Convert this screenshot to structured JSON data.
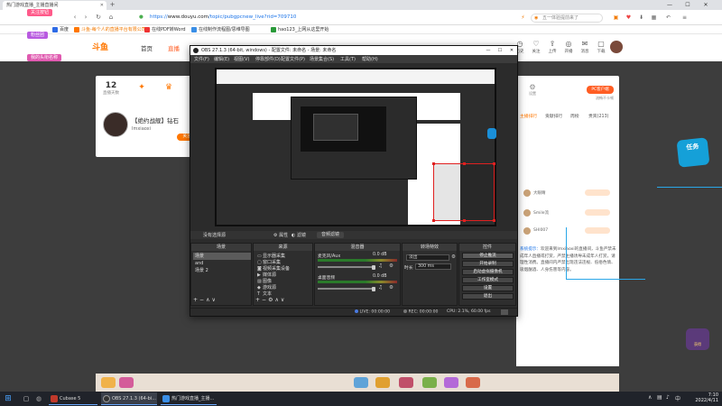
{
  "browser": {
    "tab_title": "热门游戏直播_主播直播间",
    "url_host": "www.douyu.com",
    "url_path": "/topic/pubgpcnew_live?rid=709710",
    "url_scheme": "https://",
    "search_placeholder": "五一体验提前来了",
    "bookmarks": [
      "百度",
      "斗鱼-每个人的直播平台有限公司",
      "在线PDF转Word",
      "在线制作流程图/思维导图",
      "hao123_上网从这里开始"
    ]
  },
  "overlays": {
    "tag1": "关注按钮",
    "tag2": "粉丝团",
    "tag3": "我的头衔名称"
  },
  "site": {
    "logo": "斗鱼",
    "nav": [
      "首页",
      "直播"
    ],
    "header_icons": [
      {
        "icon": "history-icon",
        "label": "历史"
      },
      {
        "icon": "follow-icon",
        "label": "关注"
      },
      {
        "icon": "upload-icon",
        "label": "上传"
      },
      {
        "icon": "broadcast-icon",
        "label": "开播"
      },
      {
        "icon": "message-icon",
        "label": "消息"
      },
      {
        "icon": "app-icon",
        "label": "下载"
      }
    ]
  },
  "room": {
    "count": "12",
    "count_label": "直播天数",
    "title": "【绝约战舰】钻石",
    "streamer": "Imxiaoxi",
    "follow_label": "关注",
    "pc_button": "PC客户端",
    "pc_sub": "流畅不卡顿",
    "settings_label": "设置"
  },
  "sidebar": {
    "tabs": [
      "主播排行",
      "贡献排行",
      "周榜",
      "贵宾(213)"
    ],
    "rank_rows": [
      "大眼睛",
      "Smile流",
      "SHI007"
    ],
    "chat_sys": "系统提示：",
    "chat_text": "欢迎来到Imxiaoxi的直播间，斗鱼严禁未成年人直播或打赏，严禁主播诱导未成年人打赏，请理性消费。直播间内严禁出现违法违规、低俗色情、吸烟酗酒、人身伤害等内容。"
  },
  "task_badge": "任务",
  "bottom_badge": "获得",
  "obs": {
    "title": "OBS 27.1.3 (64-bit, windows) - 配置文件: 未命名 - 场景: 未命名",
    "menu": [
      "文件(F)",
      "编辑(E)",
      "视图(V)",
      "停靠部件(D)",
      "配置文件(P)",
      "场景集合(S)",
      "工具(T)",
      "帮助(H)"
    ],
    "no_source": "没有选择源",
    "properties": "属性",
    "filters": "滤镜",
    "filter_btn": "音频滤镜",
    "scenes_header": "场景",
    "scenes": [
      "场景",
      "and",
      "场景 2"
    ],
    "sources_header": "来源",
    "sources": [
      "显示器采集",
      "窗口采集",
      "视频采集设备",
      "媒体源",
      "图像",
      "游戏源",
      "文本"
    ],
    "mixer_header": "混音器",
    "mixer": [
      {
        "name": "桌面音频",
        "db": "0.0 dB"
      },
      {
        "name": "麦克风/Aux",
        "db": "0.0 dB"
      }
    ],
    "transitions_header": "转场特效",
    "transition_type": "淡出",
    "duration_label": "时长",
    "duration": "300 ms",
    "controls_header": "控件",
    "controls": [
      "停止推流",
      "开始录制",
      "启动虚拟摄像机",
      "工作室模式",
      "设置",
      "退出"
    ],
    "status": {
      "live": "LIVE: 00:00:00",
      "rec": "REC: 00:00:00",
      "cpu": "CPU: 2.1%, 60.00 fps"
    }
  },
  "taskbar": {
    "apps": [
      "Cubase 5",
      "OBS 27.1.3 (64-bi...",
      "热门游戏直播_主播..."
    ],
    "time": "7:10",
    "date": "2022/4/11"
  },
  "colors": {
    "accent": "#ff7700",
    "obs_bg": "#2b2b2b",
    "cyan": "#2aa7e8"
  }
}
